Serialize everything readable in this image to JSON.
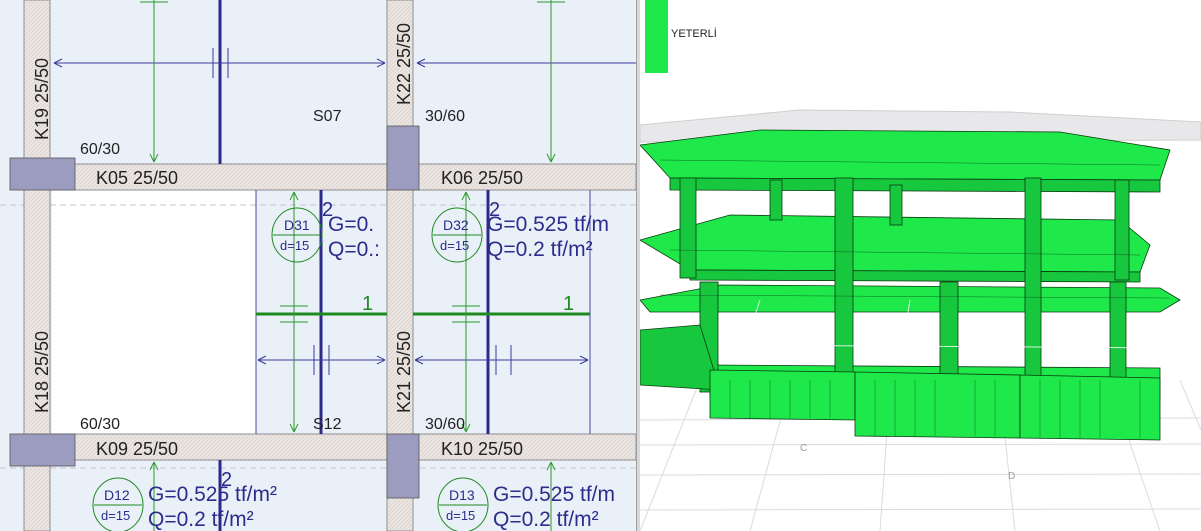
{
  "plan": {
    "columns": {
      "k19": "K19 25/50",
      "k22": "K22 25/50",
      "k18": "K18 25/50",
      "k21": "K21 25/50"
    },
    "beams": {
      "k05": "K05 25/50",
      "k06": "K06 25/50",
      "k09": "K09 25/50",
      "k10": "K10 25/50"
    },
    "column_sizes": {
      "a": "60/30",
      "b": "30/60",
      "c": "60/30",
      "d": "30/60"
    },
    "spaces": {
      "s07": "S07",
      "s12": "S12"
    },
    "slabs": [
      {
        "id": "D31",
        "d": "d=15",
        "g": "G=0.",
        "q": "Q=0.:"
      },
      {
        "id": "D32",
        "d": "d=15",
        "g": "G=0.525 tf/m",
        "q": "Q=0.2 tf/m²"
      },
      {
        "id": "D12",
        "d": "d=15",
        "g": "G=0.525 tf/m²",
        "q": "Q=0.2 tf/m²"
      },
      {
        "id": "D13",
        "d": "d=15",
        "g": "G=0.525 tf/m",
        "q": "Q=0.2 tf/m²"
      }
    ],
    "axis_labels": {
      "a1": "2",
      "a2": "2",
      "a3": "2",
      "a4": "1",
      "a5": "1"
    }
  },
  "model": {
    "legend": {
      "label": "YETERLİ",
      "color": "#1ee84a"
    },
    "grid_labels": {
      "c": "C",
      "d": "D"
    }
  },
  "colors": {
    "plan_bg": "#eaf0f8",
    "beam_fill": "#e6e0dc",
    "column_fill": "#9c9cc0",
    "slab_text": "#2c2c8c",
    "dim_blue": "#3a3a9c",
    "green_line": "#1f8a1f",
    "model_green": "#1ee84a"
  }
}
